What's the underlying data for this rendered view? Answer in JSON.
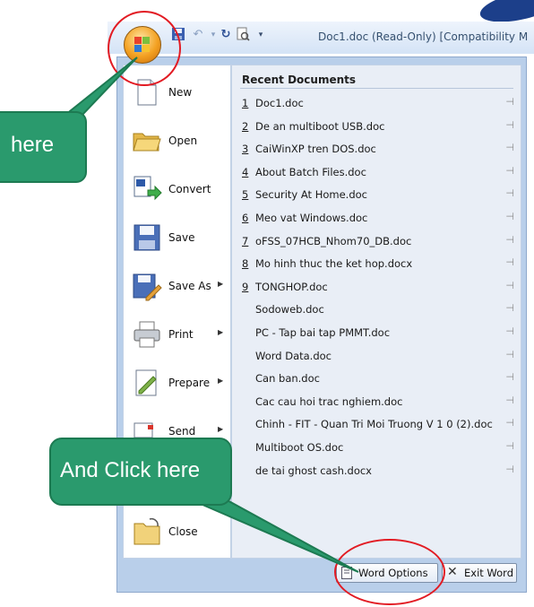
{
  "title_bar": {
    "title": "Doc1.doc (Read-Only) [Compatibility M",
    "quick_access": [
      {
        "icon": "save-icon"
      },
      {
        "icon": "undo-icon"
      },
      {
        "icon": "redo-icon"
      },
      {
        "icon": "print-preview-icon"
      },
      {
        "icon": "customize-dropdown-icon"
      }
    ]
  },
  "office_button": {
    "icon": "office-orb-icon"
  },
  "menu": {
    "commands": [
      {
        "label": "New",
        "icon": "new-document-icon",
        "submenu": false
      },
      {
        "label": "Open",
        "icon": "open-folder-icon",
        "submenu": false
      },
      {
        "label": "Convert",
        "icon": "convert-icon",
        "submenu": false
      },
      {
        "label": "Save",
        "icon": "save-floppy-icon",
        "submenu": false
      },
      {
        "label": "Save As",
        "icon": "save-as-icon",
        "submenu": true
      },
      {
        "label": "Print",
        "icon": "printer-icon",
        "submenu": true
      },
      {
        "label": "Prepare",
        "icon": "prepare-icon",
        "submenu": true
      },
      {
        "label": "Send",
        "icon": "send-icon",
        "submenu": true
      },
      {
        "label": "Close",
        "icon": "close-folder-icon",
        "submenu": false
      }
    ],
    "recent_title": "Recent Documents",
    "recent_documents": [
      {
        "num": "1",
        "name": "Doc1.doc"
      },
      {
        "num": "2",
        "name": "De an multiboot USB.doc"
      },
      {
        "num": "3",
        "name": "CaiWinXP tren DOS.doc"
      },
      {
        "num": "4",
        "name": "About Batch Files.doc"
      },
      {
        "num": "5",
        "name": "Security At Home.doc"
      },
      {
        "num": "6",
        "name": "Meo vat Windows.doc"
      },
      {
        "num": "7",
        "name": "oFSS_07HCB_Nhom70_DB.doc"
      },
      {
        "num": "8",
        "name": "Mo hinh thuc the ket hop.docx"
      },
      {
        "num": "9",
        "name": "TONGHOP.doc"
      },
      {
        "num": "",
        "name": "Sodoweb.doc"
      },
      {
        "num": "",
        "name": "PC - Tap bai tap PMMT.doc"
      },
      {
        "num": "",
        "name": "Word Data.doc"
      },
      {
        "num": "",
        "name": "Can ban.doc"
      },
      {
        "num": "",
        "name": "Cac cau hoi trac nghiem.doc"
      },
      {
        "num": "",
        "name": "Chinh - FIT - Quan Tri Moi Truong V 1 0 (2).doc"
      },
      {
        "num": "",
        "name": "Multiboot OS.doc"
      },
      {
        "num": "",
        "name": "de tai ghost cash.docx"
      }
    ],
    "pin_icon": "pin-icon",
    "word_options_label": "Word Options",
    "exit_word_label": "Exit Word"
  },
  "annotations": {
    "here_label": "here",
    "click_label": "And Click here"
  },
  "colors": {
    "callout": "#2a9a6d",
    "highlight_circle": "#e21b23",
    "menu_frame": "#b9cfea"
  }
}
